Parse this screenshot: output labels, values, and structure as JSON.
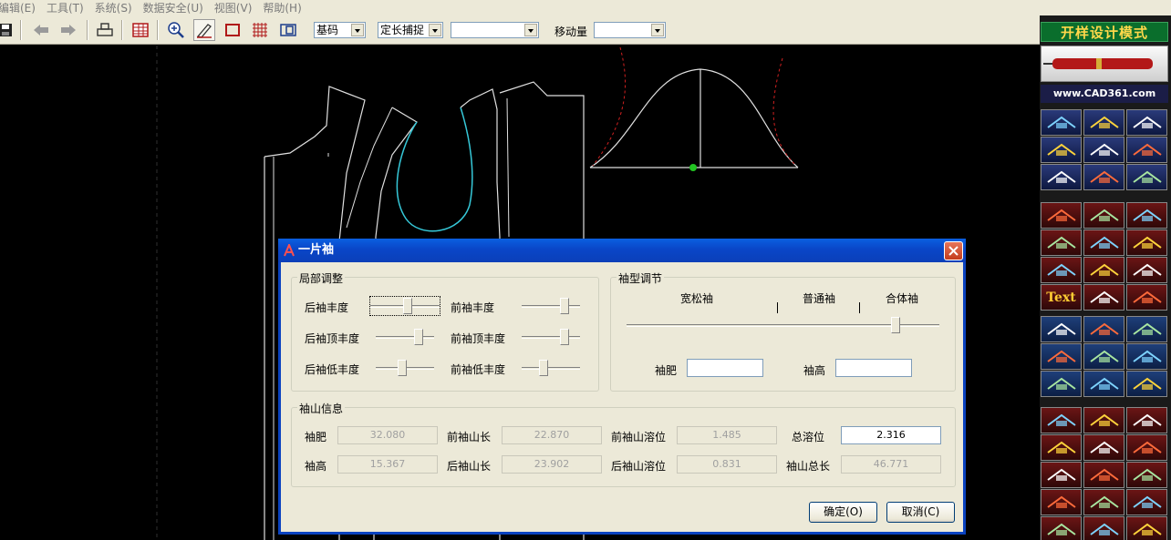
{
  "menu": [
    "编辑(E)",
    "工具(T)",
    "系统(S)",
    "数据安全(U)",
    "视图(V)",
    "帮助(H)"
  ],
  "toolbar": {
    "combo_size": "基码",
    "combo_snap": "定长捕捉",
    "combo_empty": "",
    "move_label": "移动量",
    "move_value": ""
  },
  "right_panel": {
    "title": "开样设计模式",
    "site": "www.CAD361.com",
    "text_button": "Text"
  },
  "dialog": {
    "title": "一片袖",
    "local_adjust": {
      "title": "局部调整",
      "back_sleeve": "后袖丰度",
      "front_sleeve": "前袖丰度",
      "back_top": "后袖顶丰度",
      "front_top": "前袖顶丰度",
      "back_low": "后袖低丰度",
      "front_low": "前袖低丰度",
      "levels": {
        "back_sleeve": 0.55,
        "front_sleeve": 0.78,
        "back_top": 0.78,
        "front_top": 0.78,
        "back_low": 0.45,
        "front_low": 0.35
      }
    },
    "sleeve_type": {
      "title": "袖型调节",
      "loose": "宽松袖",
      "normal": "普通袖",
      "fitted": "合体袖",
      "level": 0.87,
      "width_label": "袖肥",
      "width_value": "",
      "height_label": "袖高",
      "height_value": ""
    },
    "cap_info": {
      "title": "袖山信息",
      "width_label": "袖肥",
      "width_value": "32.080",
      "height_label": "袖高",
      "height_value": "15.367",
      "front_len_label": "前袖山长",
      "front_len_value": "22.870",
      "back_len_label": "后袖山长",
      "back_len_value": "23.902",
      "front_ease_label": "前袖山溶位",
      "front_ease_value": "1.485",
      "back_ease_label": "后袖山溶位",
      "back_ease_value": "0.831",
      "total_ease_label": "总溶位",
      "total_ease_value": "2.316",
      "total_len_label": "袖山总长",
      "total_len_value": "46.771"
    },
    "ok": "确定(O)",
    "cancel": "取消(C)"
  }
}
